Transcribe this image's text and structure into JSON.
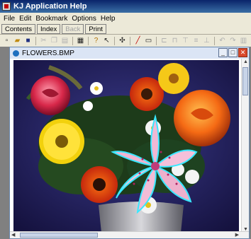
{
  "window": {
    "title": "KJ Application Help"
  },
  "menu": [
    "File",
    "Edit",
    "Bookmark",
    "Options",
    "Help"
  ],
  "nav_buttons": [
    {
      "label": "Contents",
      "enabled": true
    },
    {
      "label": "Index",
      "enabled": true
    },
    {
      "label": "Back",
      "enabled": false
    },
    {
      "label": "Print",
      "enabled": true
    }
  ],
  "toolbar_icons": [
    "new-icon",
    "open-icon",
    "save-icon",
    "cut-icon",
    "copy-icon",
    "paste-icon",
    "print-icon",
    "help-icon",
    "context-help-icon",
    "move-icon",
    "pencil-icon",
    "rectangle-icon",
    "align-left-icon",
    "align-center-icon",
    "align-top-icon",
    "align-middle-icon",
    "align-bottom-icon",
    "undo-icon",
    "redo-icon",
    "grid-icon"
  ],
  "document": {
    "title": "FLOWERS.BMP"
  }
}
